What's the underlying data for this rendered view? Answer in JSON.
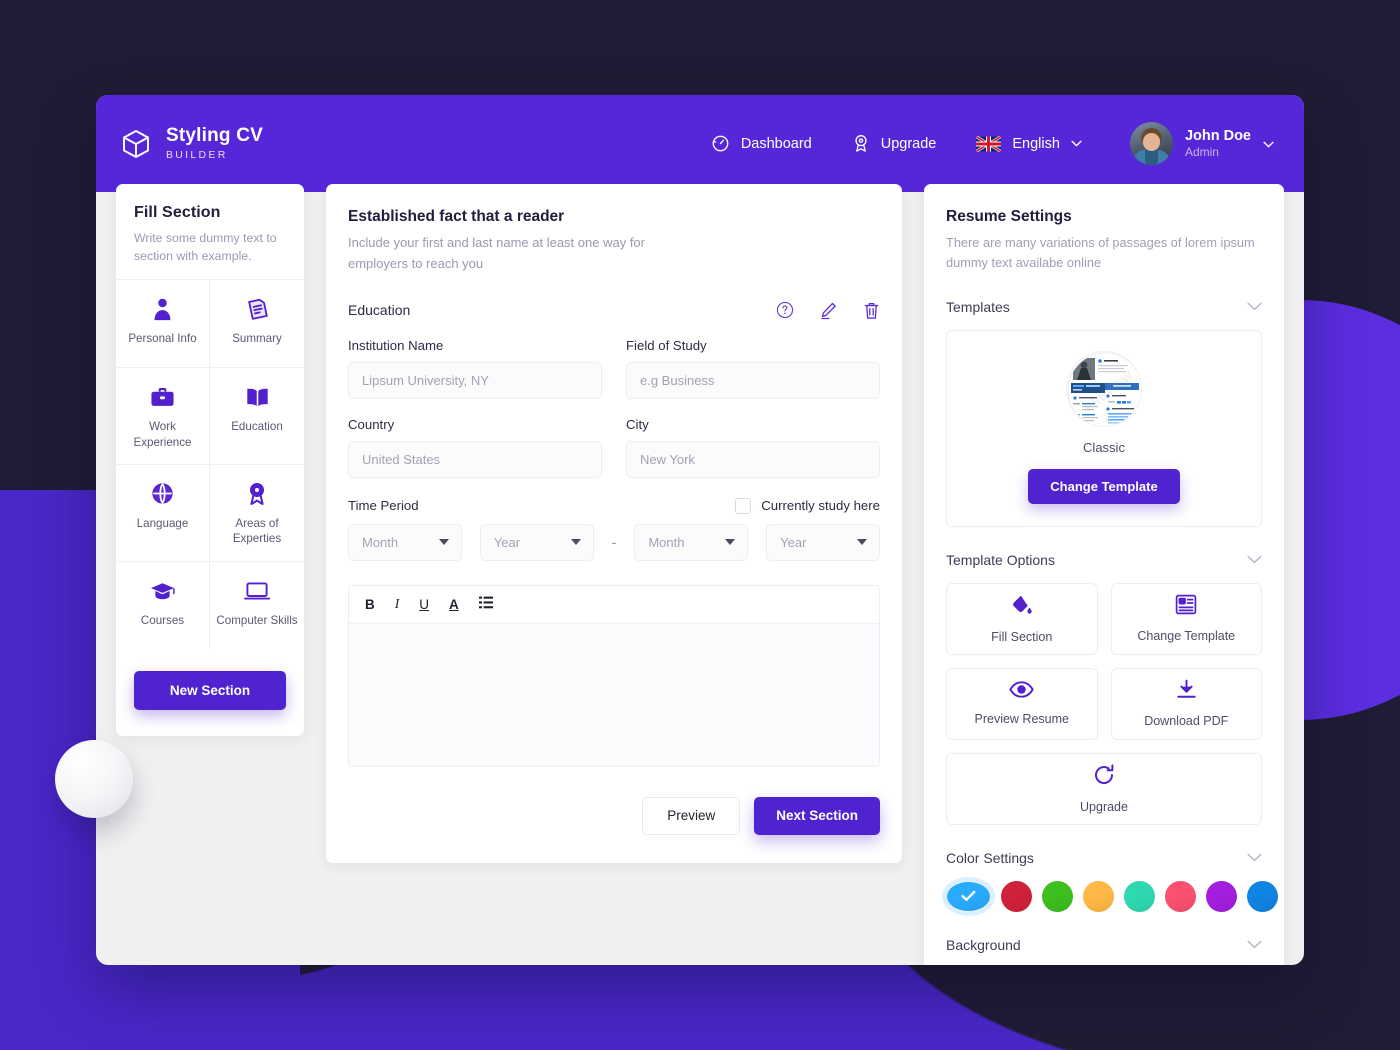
{
  "header": {
    "brand_title": "Styling CV",
    "brand_sub": "BUILDER",
    "nav": [
      {
        "label": "Dashboard",
        "icon": "dashboard-icon"
      },
      {
        "label": "Upgrade",
        "icon": "award-icon"
      }
    ],
    "language": {
      "label": "English",
      "flag": "uk-flag-icon",
      "chevron": "chevron-down-icon"
    },
    "user": {
      "name": "John Doe",
      "role": "Admin",
      "chevron": "chevron-down-icon",
      "avatar": "user-avatar"
    }
  },
  "left_panel": {
    "title": "Fill Section",
    "description": "Write some dummy text to section with example.",
    "sections": [
      {
        "label": "Personal Info",
        "icon": "person-icon"
      },
      {
        "label": "Summary",
        "icon": "document-list-icon"
      },
      {
        "label": "Work Experience",
        "icon": "briefcase-icon"
      },
      {
        "label": "Education",
        "icon": "open-book-icon"
      },
      {
        "label": "Language",
        "icon": "globe-icon"
      },
      {
        "label": "Areas of Experties",
        "icon": "ribbon-badge-icon"
      },
      {
        "label": "Courses",
        "icon": "graduation-cap-icon"
      },
      {
        "label": "Computer Skills",
        "icon": "laptop-icon"
      }
    ],
    "new_section_label": "New Section"
  },
  "center_panel": {
    "title": "Established fact that a reader",
    "description": "Include your first and last name at least one way for employers to reach you",
    "section_name": "Education",
    "actions": [
      {
        "name": "help-icon"
      },
      {
        "name": "edit-pencil-icon"
      },
      {
        "name": "trash-icon"
      }
    ],
    "fields": {
      "institution_label": "Institution Name",
      "institution_placeholder": "Lipsum University, NY",
      "institution_value": "",
      "field_of_study_label": "Field of Study",
      "field_of_study_placeholder": "e.g Business",
      "field_of_study_value": "",
      "country_label": "Country",
      "country_placeholder": "United States",
      "country_value": "",
      "city_label": "City",
      "city_placeholder": "New York",
      "city_value": ""
    },
    "time_period": {
      "label": "Time Period",
      "currently_label": "Currently study here",
      "currently_checked": false,
      "start_month": "Month",
      "start_year": "Year",
      "separator": "-",
      "end_month": "Month",
      "end_year": "Year"
    },
    "editor": {
      "tools": [
        {
          "label": "B",
          "name": "bold-icon"
        },
        {
          "label": "I",
          "name": "italic-icon"
        },
        {
          "label": "U",
          "name": "underline-icon"
        },
        {
          "label": "A",
          "name": "text-color-icon"
        },
        {
          "label": "",
          "name": "bullet-list-icon"
        }
      ],
      "content": ""
    },
    "preview_label": "Preview",
    "next_label": "Next Section"
  },
  "right_panel": {
    "title": "Resume Settings",
    "description": "There are many variations of passages of lorem ipsum dummy text availabe online",
    "templates": {
      "heading": "Templates",
      "current_name": "Classic",
      "change_label": "Change Template"
    },
    "template_options": {
      "heading": "Template Options",
      "items": [
        {
          "label": "Fill Section",
          "icon": "paint-bucket-icon"
        },
        {
          "label": "Change Template",
          "icon": "layout-grid-icon"
        },
        {
          "label": "Preview Resume",
          "icon": "eye-icon"
        },
        {
          "label": "Download PDF",
          "icon": "download-icon"
        },
        {
          "label": "Upgrade",
          "icon": "refresh-upgrade-icon"
        }
      ]
    },
    "color_settings": {
      "heading": "Color Settings",
      "selected_index": 0,
      "colors": [
        "#29abff",
        "#d0213a",
        "#3cbf1f",
        "#ffb946",
        "#2fd9b0",
        "#fb5070",
        "#a41ee0",
        "#1084e3"
      ]
    },
    "background": {
      "heading": "Background",
      "selected_index": 0,
      "patterns": [
        "check-selected",
        "circles",
        "diagonal-lines",
        "hatched-dots",
        "dots-sparse",
        "burst",
        "dots-scatter",
        "brush-strokes"
      ]
    }
  },
  "theme": {
    "accent": "#4f23cf",
    "header_bg": "#5627d9",
    "page_bg": "#211c35",
    "deco_purple": "#4a27c9"
  }
}
